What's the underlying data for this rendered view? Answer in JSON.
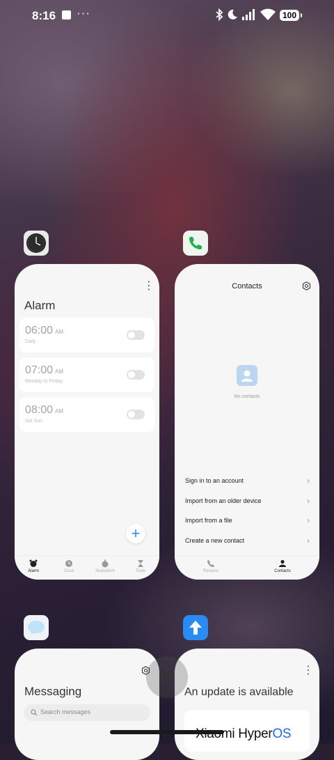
{
  "status_bar": {
    "time": "8:16",
    "more": "···",
    "battery": "100"
  },
  "clock_card": {
    "app_icon": "clock-app-icon",
    "title": "Alarm",
    "alarms": [
      {
        "time": "06:00",
        "ampm": "AM",
        "repeat": "Daily",
        "enabled": false
      },
      {
        "time": "07:00",
        "ampm": "AM",
        "repeat": "Monday to Friday",
        "enabled": false
      },
      {
        "time": "08:00",
        "ampm": "AM",
        "repeat": "Sat Sun",
        "enabled": false
      }
    ],
    "fab": "+",
    "nav": [
      "Alarm",
      "Clock",
      "Stopwatch",
      "Timer"
    ],
    "active_nav": "Alarm"
  },
  "contacts_card": {
    "app_icon": "phone-app-icon",
    "title": "Contacts",
    "empty_label": "No contacts",
    "menu": [
      "Sign in to an account",
      "Import from an older device",
      "Import from a file",
      "Create a new contact"
    ],
    "nav": [
      "Recents",
      "Contacts"
    ],
    "active_nav": "Contacts"
  },
  "messaging_card": {
    "app_icon": "messaging-app-icon",
    "title": "Messaging",
    "search_placeholder": "Search messages"
  },
  "update_card": {
    "app_icon": "updater-app-icon",
    "title": "An update is available",
    "brand_prefix": "Xiaomi Hyper",
    "brand_suffix": "OS"
  },
  "close_all": "✕",
  "colors": {
    "accent_blue": "#2e8bff",
    "brand_blue": "#2566e8",
    "card_bg": "#f6f6f6"
  }
}
